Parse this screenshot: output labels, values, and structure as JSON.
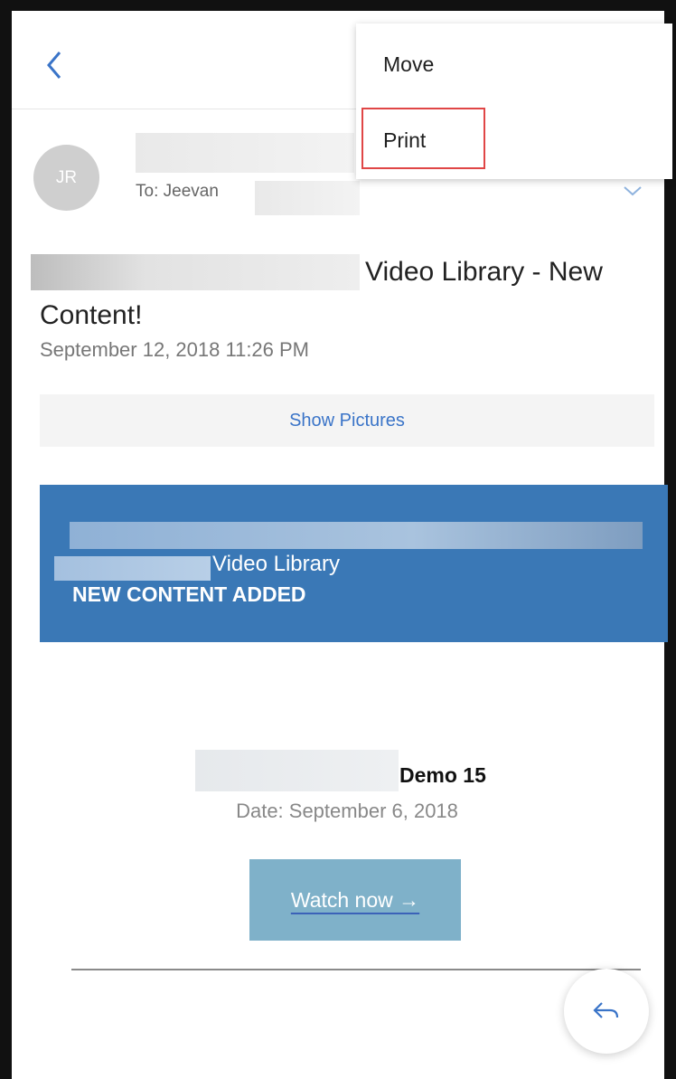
{
  "menu": {
    "items": [
      "Move",
      "Print"
    ],
    "highlighted": "Print"
  },
  "message": {
    "avatar_initials": "JR",
    "to_label": "To: Jeevan",
    "subject_part1": "Video Library - New",
    "subject_part2": "Content!",
    "date": "September 12, 2018 11:26 PM"
  },
  "actions": {
    "show_pictures": "Show Pictures"
  },
  "email_body": {
    "banner_library": "Video Library",
    "banner_headline": "NEW CONTENT ADDED",
    "item_title": "Demo 15",
    "item_date": "Date: September 6, 2018",
    "watch_label": "Watch now →"
  },
  "colors": {
    "accent": "#3a78b6",
    "link": "#3a74c8",
    "highlight_border": "#e04646",
    "watch_button": "#7fb1c9"
  },
  "icons": {
    "back": "back-chevron-icon",
    "expand": "chevron-down-icon",
    "reply": "reply-icon"
  }
}
